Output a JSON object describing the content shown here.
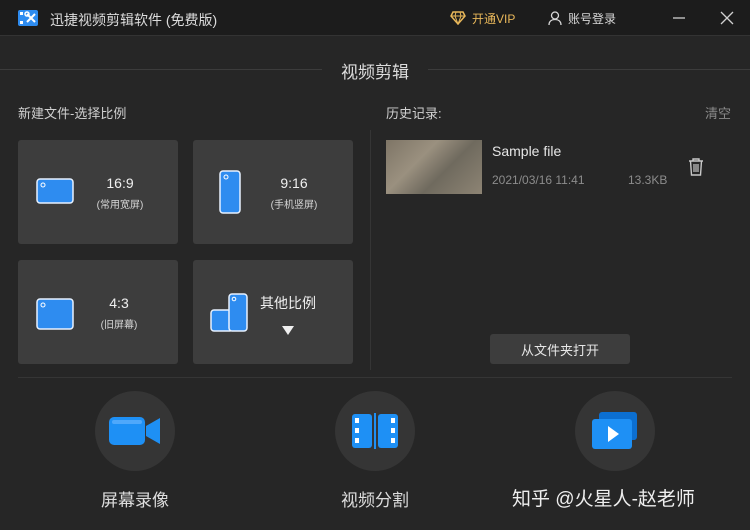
{
  "titlebar": {
    "app_title": "迅捷视频剪辑软件 (免费版)",
    "vip_label": "开通VIP",
    "account_label": "账号登录",
    "icons": [
      "app-logo",
      "diamond-icon",
      "user-icon",
      "minimize-icon",
      "close-icon"
    ]
  },
  "main": {
    "section_title": "视频剪辑",
    "new_file_label": "新建文件-选择比例",
    "history_label": "历史记录:",
    "clear_label": "清空"
  },
  "ratios": [
    {
      "ratio": "16:9",
      "desc": "(常用宽屏)"
    },
    {
      "ratio": "9:16",
      "desc": "(手机竖屏)"
    },
    {
      "ratio": "4:3",
      "desc": "(旧屏幕)"
    },
    {
      "ratio": "其他比例",
      "desc": ""
    }
  ],
  "history": {
    "file_name": "Sample file",
    "file_date": "2021/03/16 11:41",
    "file_size": "13.3KB",
    "open_folder_label": "从文件夹打开"
  },
  "tools": [
    {
      "label": "屏幕录像",
      "icon": "camera-icon"
    },
    {
      "label": "视频分割",
      "icon": "film-split-icon"
    },
    {
      "label": "",
      "icon": "video-play-icon"
    }
  ],
  "watermark": "知乎 @火星人-赵老师",
  "colors": {
    "background": "#262626",
    "titlebar": "#1c1c1c",
    "card": "#3d3d3d",
    "accent_blue": "#2e8cf0",
    "vip_gold": "#e8b75a"
  }
}
